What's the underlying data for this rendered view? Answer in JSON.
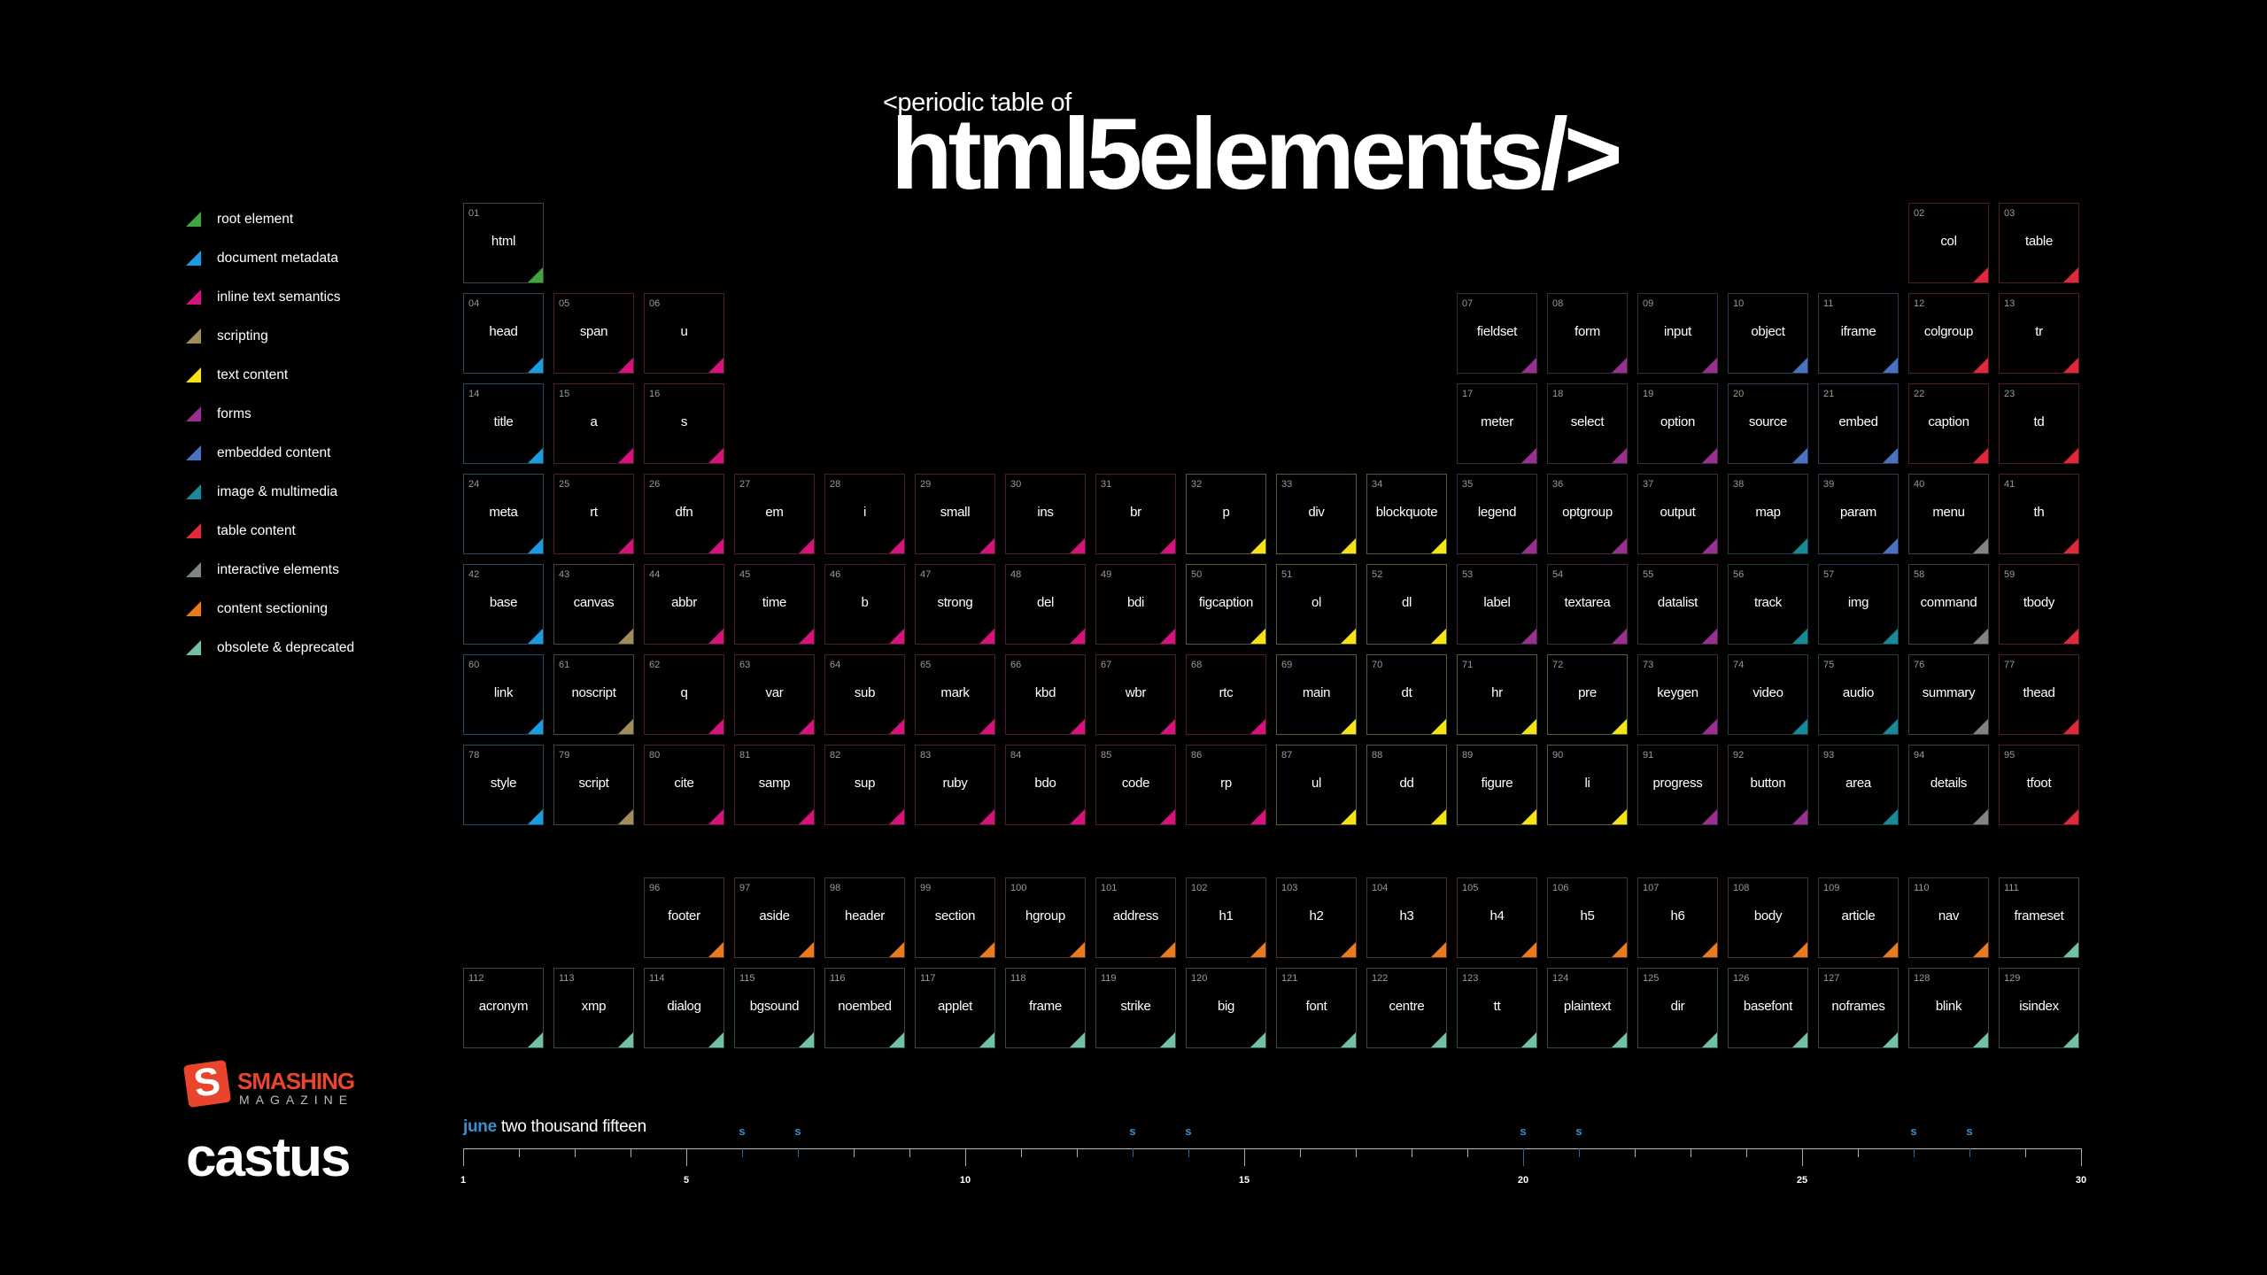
{
  "header": {
    "pre_title": "<periodic table of",
    "main_title": "html5elements/>"
  },
  "categories": {
    "root": {
      "label": "root element",
      "color": "#3fa53f",
      "border": "#3b4a3b"
    },
    "metadata": {
      "label": "document metadata",
      "color": "#1b9be0",
      "border": "#274a63"
    },
    "inline": {
      "label": "inline text semantics",
      "color": "#d8127c",
      "border": "#4a1d33"
    },
    "scripting": {
      "label": "scripting",
      "color": "#a38c5c",
      "border": "#4a4535"
    },
    "text": {
      "label": "text content",
      "color": "#f5e412",
      "border": "#5a5a3a"
    },
    "forms": {
      "label": "forms",
      "color": "#9a2f91",
      "border": "#3f2a3d"
    },
    "embedded": {
      "label": "embedded content",
      "color": "#4a72c0",
      "border": "#2d3a55"
    },
    "media": {
      "label": "image & multimedia",
      "color": "#168a99",
      "border": "#223d43"
    },
    "table": {
      "label": "table content",
      "color": "#e0283a",
      "border": "#4d1f25"
    },
    "interactive": {
      "label": "interactive elements",
      "color": "#7f8586",
      "border": "#3d3f40"
    },
    "sectioning": {
      "label": "content sectioning",
      "color": "#ea7a1c",
      "border": "#4a3428"
    },
    "obsolete": {
      "label": "obsolete & deprecated",
      "color": "#72c1a5",
      "border": "#354a43"
    }
  },
  "legend_order": [
    "root",
    "metadata",
    "inline",
    "scripting",
    "text",
    "forms",
    "embedded",
    "media",
    "table",
    "interactive",
    "sectioning",
    "obsolete"
  ],
  "elements": [
    {
      "num": "01",
      "name": "html",
      "cat": "root",
      "row": 0,
      "col": 0
    },
    {
      "num": "02",
      "name": "col",
      "cat": "table",
      "row": 0,
      "col": 16
    },
    {
      "num": "03",
      "name": "table",
      "cat": "table",
      "row": 0,
      "col": 17
    },
    {
      "num": "04",
      "name": "head",
      "cat": "metadata",
      "row": 1,
      "col": 0
    },
    {
      "num": "05",
      "name": "span",
      "cat": "inline",
      "row": 1,
      "col": 1
    },
    {
      "num": "06",
      "name": "u",
      "cat": "inline",
      "row": 1,
      "col": 2
    },
    {
      "num": "07",
      "name": "fieldset",
      "cat": "forms",
      "row": 1,
      "col": 11
    },
    {
      "num": "08",
      "name": "form",
      "cat": "forms",
      "row": 1,
      "col": 12
    },
    {
      "num": "09",
      "name": "input",
      "cat": "forms",
      "row": 1,
      "col": 13
    },
    {
      "num": "10",
      "name": "object",
      "cat": "embedded",
      "row": 1,
      "col": 14
    },
    {
      "num": "11",
      "name": "iframe",
      "cat": "embedded",
      "row": 1,
      "col": 15
    },
    {
      "num": "12",
      "name": "colgroup",
      "cat": "table",
      "row": 1,
      "col": 16
    },
    {
      "num": "13",
      "name": "tr",
      "cat": "table",
      "row": 1,
      "col": 17
    },
    {
      "num": "14",
      "name": "title",
      "cat": "metadata",
      "row": 2,
      "col": 0
    },
    {
      "num": "15",
      "name": "a",
      "cat": "inline",
      "row": 2,
      "col": 1
    },
    {
      "num": "16",
      "name": "s",
      "cat": "inline",
      "row": 2,
      "col": 2
    },
    {
      "num": "17",
      "name": "meter",
      "cat": "forms",
      "row": 2,
      "col": 11
    },
    {
      "num": "18",
      "name": "select",
      "cat": "forms",
      "row": 2,
      "col": 12
    },
    {
      "num": "19",
      "name": "option",
      "cat": "forms",
      "row": 2,
      "col": 13
    },
    {
      "num": "20",
      "name": "source",
      "cat": "embedded",
      "row": 2,
      "col": 14
    },
    {
      "num": "21",
      "name": "embed",
      "cat": "embedded",
      "row": 2,
      "col": 15
    },
    {
      "num": "22",
      "name": "caption",
      "cat": "table",
      "row": 2,
      "col": 16
    },
    {
      "num": "23",
      "name": "td",
      "cat": "table",
      "row": 2,
      "col": 17
    },
    {
      "num": "24",
      "name": "meta",
      "cat": "metadata",
      "row": 3,
      "col": 0
    },
    {
      "num": "25",
      "name": "rt",
      "cat": "inline",
      "row": 3,
      "col": 1
    },
    {
      "num": "26",
      "name": "dfn",
      "cat": "inline",
      "row": 3,
      "col": 2
    },
    {
      "num": "27",
      "name": "em",
      "cat": "inline",
      "row": 3,
      "col": 3
    },
    {
      "num": "28",
      "name": "i",
      "cat": "inline",
      "row": 3,
      "col": 4
    },
    {
      "num": "29",
      "name": "small",
      "cat": "inline",
      "row": 3,
      "col": 5
    },
    {
      "num": "30",
      "name": "ins",
      "cat": "inline",
      "row": 3,
      "col": 6
    },
    {
      "num": "31",
      "name": "br",
      "cat": "inline",
      "row": 3,
      "col": 7
    },
    {
      "num": "32",
      "name": "p",
      "cat": "text",
      "row": 3,
      "col": 8
    },
    {
      "num": "33",
      "name": "div",
      "cat": "text",
      "row": 3,
      "col": 9
    },
    {
      "num": "34",
      "name": "blockquote",
      "cat": "text",
      "row": 3,
      "col": 10
    },
    {
      "num": "35",
      "name": "legend",
      "cat": "forms",
      "row": 3,
      "col": 11
    },
    {
      "num": "36",
      "name": "optgroup",
      "cat": "forms",
      "row": 3,
      "col": 12
    },
    {
      "num": "37",
      "name": "output",
      "cat": "forms",
      "row": 3,
      "col": 13
    },
    {
      "num": "38",
      "name": "map",
      "cat": "media",
      "row": 3,
      "col": 14
    },
    {
      "num": "39",
      "name": "param",
      "cat": "embedded",
      "row": 3,
      "col": 15
    },
    {
      "num": "40",
      "name": "menu",
      "cat": "interactive",
      "row": 3,
      "col": 16
    },
    {
      "num": "41",
      "name": "th",
      "cat": "table",
      "row": 3,
      "col": 17
    },
    {
      "num": "42",
      "name": "base",
      "cat": "metadata",
      "row": 4,
      "col": 0
    },
    {
      "num": "43",
      "name": "canvas",
      "cat": "scripting",
      "row": 4,
      "col": 1
    },
    {
      "num": "44",
      "name": "abbr",
      "cat": "inline",
      "row": 4,
      "col": 2
    },
    {
      "num": "45",
      "name": "time",
      "cat": "inline",
      "row": 4,
      "col": 3
    },
    {
      "num": "46",
      "name": "b",
      "cat": "inline",
      "row": 4,
      "col": 4
    },
    {
      "num": "47",
      "name": "strong",
      "cat": "inline",
      "row": 4,
      "col": 5
    },
    {
      "num": "48",
      "name": "del",
      "cat": "inline",
      "row": 4,
      "col": 6
    },
    {
      "num": "49",
      "name": "bdi",
      "cat": "inline",
      "row": 4,
      "col": 7
    },
    {
      "num": "50",
      "name": "figcaption",
      "cat": "text",
      "row": 4,
      "col": 8
    },
    {
      "num": "51",
      "name": "ol",
      "cat": "text",
      "row": 4,
      "col": 9
    },
    {
      "num": "52",
      "name": "dl",
      "cat": "text",
      "row": 4,
      "col": 10
    },
    {
      "num": "53",
      "name": "label",
      "cat": "forms",
      "row": 4,
      "col": 11
    },
    {
      "num": "54",
      "name": "textarea",
      "cat": "forms",
      "row": 4,
      "col": 12
    },
    {
      "num": "55",
      "name": "datalist",
      "cat": "forms",
      "row": 4,
      "col": 13
    },
    {
      "num": "56",
      "name": "track",
      "cat": "media",
      "row": 4,
      "col": 14
    },
    {
      "num": "57",
      "name": "img",
      "cat": "media",
      "row": 4,
      "col": 15
    },
    {
      "num": "58",
      "name": "command",
      "cat": "interactive",
      "row": 4,
      "col": 16
    },
    {
      "num": "59",
      "name": "tbody",
      "cat": "table",
      "row": 4,
      "col": 17
    },
    {
      "num": "60",
      "name": "link",
      "cat": "metadata",
      "row": 5,
      "col": 0
    },
    {
      "num": "61",
      "name": "noscript",
      "cat": "scripting",
      "row": 5,
      "col": 1
    },
    {
      "num": "62",
      "name": "q",
      "cat": "inline",
      "row": 5,
      "col": 2
    },
    {
      "num": "63",
      "name": "var",
      "cat": "inline",
      "row": 5,
      "col": 3
    },
    {
      "num": "64",
      "name": "sub",
      "cat": "inline",
      "row": 5,
      "col": 4
    },
    {
      "num": "65",
      "name": "mark",
      "cat": "inline",
      "row": 5,
      "col": 5
    },
    {
      "num": "66",
      "name": "kbd",
      "cat": "inline",
      "row": 5,
      "col": 6
    },
    {
      "num": "67",
      "name": "wbr",
      "cat": "inline",
      "row": 5,
      "col": 7
    },
    {
      "num": "68",
      "name": "rtc",
      "cat": "inline",
      "row": 5,
      "col": 8
    },
    {
      "num": "69",
      "name": "main",
      "cat": "text",
      "row": 5,
      "col": 9
    },
    {
      "num": "70",
      "name": "dt",
      "cat": "text",
      "row": 5,
      "col": 10
    },
    {
      "num": "71",
      "name": "hr",
      "cat": "text",
      "row": 5,
      "col": 11
    },
    {
      "num": "72",
      "name": "pre",
      "cat": "text",
      "row": 5,
      "col": 12
    },
    {
      "num": "73",
      "name": "keygen",
      "cat": "forms",
      "row": 5,
      "col": 13
    },
    {
      "num": "74",
      "name": "video",
      "cat": "media",
      "row": 5,
      "col": 14
    },
    {
      "num": "75",
      "name": "audio",
      "cat": "media",
      "row": 5,
      "col": 15
    },
    {
      "num": "76",
      "name": "summary",
      "cat": "interactive",
      "row": 5,
      "col": 16
    },
    {
      "num": "77",
      "name": "thead",
      "cat": "table",
      "row": 5,
      "col": 17
    },
    {
      "num": "78",
      "name": "style",
      "cat": "metadata",
      "row": 6,
      "col": 0
    },
    {
      "num": "79",
      "name": "script",
      "cat": "scripting",
      "row": 6,
      "col": 1
    },
    {
      "num": "80",
      "name": "cite",
      "cat": "inline",
      "row": 6,
      "col": 2
    },
    {
      "num": "81",
      "name": "samp",
      "cat": "inline",
      "row": 6,
      "col": 3
    },
    {
      "num": "82",
      "name": "sup",
      "cat": "inline",
      "row": 6,
      "col": 4
    },
    {
      "num": "83",
      "name": "ruby",
      "cat": "inline",
      "row": 6,
      "col": 5
    },
    {
      "num": "84",
      "name": "bdo",
      "cat": "inline",
      "row": 6,
      "col": 6
    },
    {
      "num": "85",
      "name": "code",
      "cat": "inline",
      "row": 6,
      "col": 7
    },
    {
      "num": "86",
      "name": "rp",
      "cat": "inline",
      "row": 6,
      "col": 8
    },
    {
      "num": "87",
      "name": "ul",
      "cat": "text",
      "row": 6,
      "col": 9
    },
    {
      "num": "88",
      "name": "dd",
      "cat": "text",
      "row": 6,
      "col": 10
    },
    {
      "num": "89",
      "name": "figure",
      "cat": "text",
      "row": 6,
      "col": 11
    },
    {
      "num": "90",
      "name": "li",
      "cat": "text",
      "row": 6,
      "col": 12
    },
    {
      "num": "91",
      "name": "progress",
      "cat": "forms",
      "row": 6,
      "col": 13
    },
    {
      "num": "92",
      "name": "button",
      "cat": "forms",
      "row": 6,
      "col": 14
    },
    {
      "num": "93",
      "name": "area",
      "cat": "media",
      "row": 6,
      "col": 15
    },
    {
      "num": "94",
      "name": "details",
      "cat": "interactive",
      "row": 6,
      "col": 16
    },
    {
      "num": "95",
      "name": "tfoot",
      "cat": "table",
      "row": 6,
      "col": 17
    },
    {
      "num": "96",
      "name": "footer",
      "cat": "sectioning",
      "row": 7,
      "col": 2
    },
    {
      "num": "97",
      "name": "aside",
      "cat": "sectioning",
      "row": 7,
      "col": 3
    },
    {
      "num": "98",
      "name": "header",
      "cat": "sectioning",
      "row": 7,
      "col": 4
    },
    {
      "num": "99",
      "name": "section",
      "cat": "sectioning",
      "row": 7,
      "col": 5
    },
    {
      "num": "100",
      "name": "hgroup",
      "cat": "sectioning",
      "row": 7,
      "col": 6
    },
    {
      "num": "101",
      "name": "address",
      "cat": "sectioning",
      "row": 7,
      "col": 7
    },
    {
      "num": "102",
      "name": "h1",
      "cat": "sectioning",
      "row": 7,
      "col": 8
    },
    {
      "num": "103",
      "name": "h2",
      "cat": "sectioning",
      "row": 7,
      "col": 9
    },
    {
      "num": "104",
      "name": "h3",
      "cat": "sectioning",
      "row": 7,
      "col": 10
    },
    {
      "num": "105",
      "name": "h4",
      "cat": "sectioning",
      "row": 7,
      "col": 11
    },
    {
      "num": "106",
      "name": "h5",
      "cat": "sectioning",
      "row": 7,
      "col": 12
    },
    {
      "num": "107",
      "name": "h6",
      "cat": "sectioning",
      "row": 7,
      "col": 13
    },
    {
      "num": "108",
      "name": "body",
      "cat": "sectioning",
      "row": 7,
      "col": 14
    },
    {
      "num": "109",
      "name": "article",
      "cat": "sectioning",
      "row": 7,
      "col": 15
    },
    {
      "num": "110",
      "name": "nav",
      "cat": "sectioning",
      "row": 7,
      "col": 16
    },
    {
      "num": "111",
      "name": "frameset",
      "cat": "obsolete",
      "row": 7,
      "col": 17
    },
    {
      "num": "112",
      "name": "acronym",
      "cat": "obsolete",
      "row": 8,
      "col": 0
    },
    {
      "num": "113",
      "name": "xmp",
      "cat": "obsolete",
      "row": 8,
      "col": 1
    },
    {
      "num": "114",
      "name": "dialog",
      "cat": "obsolete",
      "row": 8,
      "col": 2
    },
    {
      "num": "115",
      "name": "bgsound",
      "cat": "obsolete",
      "row": 8,
      "col": 3
    },
    {
      "num": "116",
      "name": "noembed",
      "cat": "obsolete",
      "row": 8,
      "col": 4
    },
    {
      "num": "117",
      "name": "applet",
      "cat": "obsolete",
      "row": 8,
      "col": 5
    },
    {
      "num": "118",
      "name": "frame",
      "cat": "obsolete",
      "row": 8,
      "col": 6
    },
    {
      "num": "119",
      "name": "strike",
      "cat": "obsolete",
      "row": 8,
      "col": 7
    },
    {
      "num": "120",
      "name": "big",
      "cat": "obsolete",
      "row": 8,
      "col": 8
    },
    {
      "num": "121",
      "name": "font",
      "cat": "obsolete",
      "row": 8,
      "col": 9
    },
    {
      "num": "122",
      "name": "centre",
      "cat": "obsolete",
      "row": 8,
      "col": 10
    },
    {
      "num": "123",
      "name": "tt",
      "cat": "obsolete",
      "row": 8,
      "col": 11
    },
    {
      "num": "124",
      "name": "plaintext",
      "cat": "obsolete",
      "row": 8,
      "col": 12
    },
    {
      "num": "125",
      "name": "dir",
      "cat": "obsolete",
      "row": 8,
      "col": 13
    },
    {
      "num": "126",
      "name": "basefont",
      "cat": "obsolete",
      "row": 8,
      "col": 14
    },
    {
      "num": "127",
      "name": "noframes",
      "cat": "obsolete",
      "row": 8,
      "col": 15
    },
    {
      "num": "128",
      "name": "blink",
      "cat": "obsolete",
      "row": 8,
      "col": 16
    },
    {
      "num": "129",
      "name": "isindex",
      "cat": "obsolete",
      "row": 8,
      "col": 17
    }
  ],
  "branding": {
    "logo_letter": "S",
    "publisher": "SMASHING",
    "publisher_sub": "MAGAZINE",
    "author": "castus"
  },
  "calendar": {
    "month": "june",
    "year_text": "two thousand fifteen",
    "days": 30,
    "labeled_days": [
      "1",
      "5",
      "10",
      "15",
      "20",
      "25",
      "30"
    ],
    "weekend_days": [
      6,
      7,
      13,
      14,
      20,
      21,
      27,
      28
    ],
    "weekend_label": "s",
    "accent": "#3a8fcf"
  }
}
